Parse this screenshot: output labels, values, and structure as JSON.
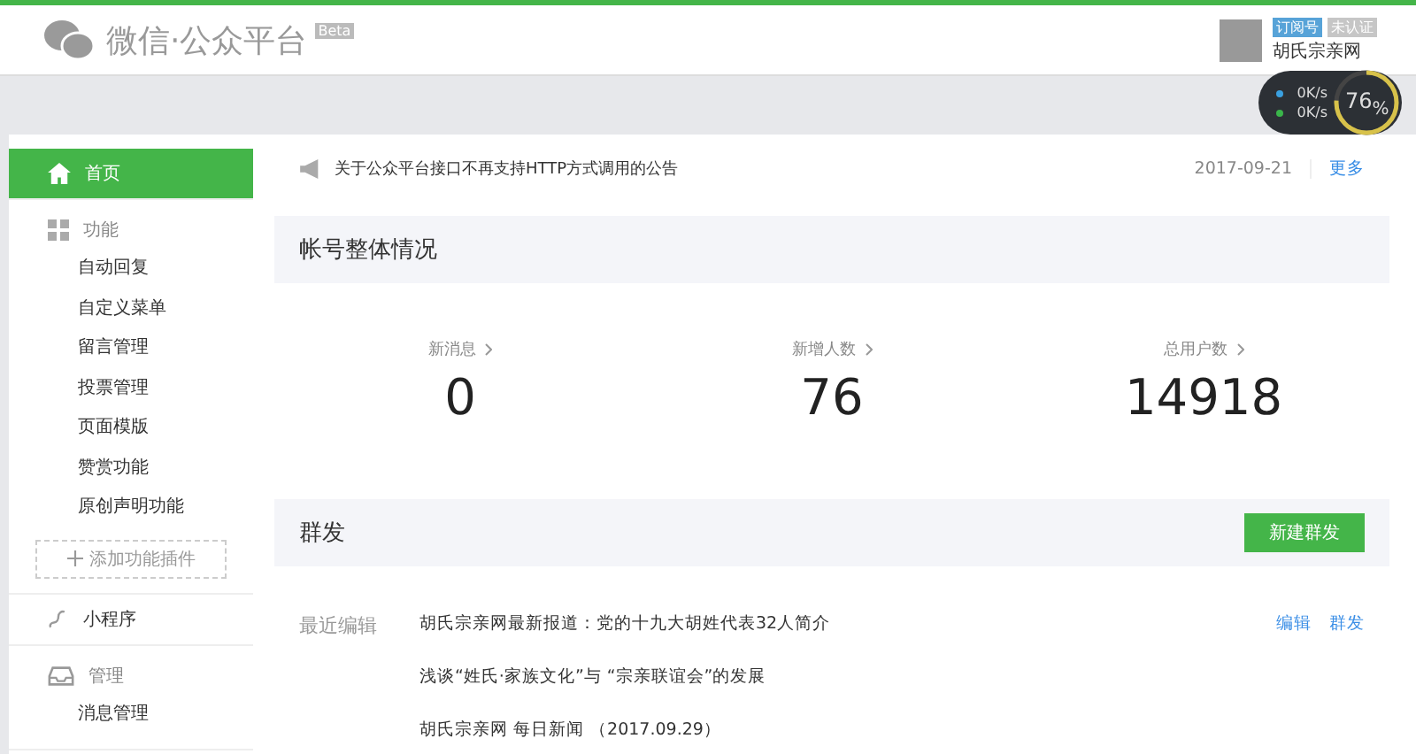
{
  "header": {
    "logo_text": "微信·公众平台",
    "beta": "Beta",
    "account_tags": [
      "订阅号",
      "未认证"
    ],
    "account_name": "胡氏宗亲网"
  },
  "speed_widget": {
    "upload": "0K/s",
    "download": "0K/s",
    "percent": "76$_{%}$",
    "level": 0.76
  },
  "sidebar": {
    "items": [
      {
        "kind": "top",
        "label": "首页",
        "selected": true
      },
      {
        "kind": "group",
        "label": "功能",
        "children": [
          {
            "label": "自动回复",
            "selected": false
          },
          {
            "label": "自定义菜单",
            "selected": false
          },
          {
            "label": "留言管理",
            "selected": false
          },
          {
            "label": "投票管理",
            "selected": false
          },
          {
            "label": "页面模版",
            "selected": false
          },
          {
            "label": "赞赏功能",
            "selected": false
          },
          {
            "label": "原创声明功能",
            "selected": false
          }
        ],
        "add_button": "添加功能插件"
      },
      {
        "kind": "top",
        "label": "小程序",
        "selected": false
      },
      {
        "kind": "group",
        "label": "管理",
        "children": [
          {
            "label": "消息管理",
            "selected": false
          }
        ]
      }
    ]
  },
  "notice": {
    "text": "关于公众平台接口不再支持HTTP方式调用的公告",
    "date": "2017-09-21",
    "more": "更多"
  },
  "account_overview": {
    "title": "帐号整体情况",
    "stats": [
      {
        "label": "新消息",
        "value": "0"
      },
      {
        "label": "新增人数",
        "value": "76"
      },
      {
        "label": "总用户数",
        "value": "14918"
      }
    ]
  },
  "mass_send": {
    "title": "群发",
    "button": "新建群发",
    "recent_label": "最近编辑",
    "recent": [
      "胡氏宗亲网最新报道：党的十九大胡姓代表32人简介",
      "浅谈“姓氏·家族文化”与 “宗亲联谊会”的发展",
      "胡氏宗亲网 每日新闻 （2017.09.29）"
    ],
    "actions": [
      "编辑",
      "群发"
    ]
  }
}
